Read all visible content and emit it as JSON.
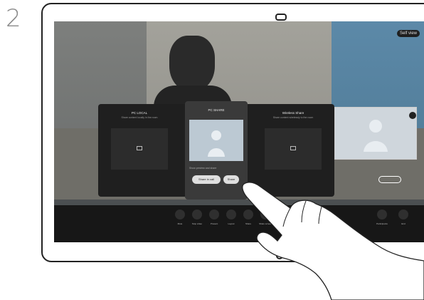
{
  "step": {
    "number": "2"
  },
  "selfview": {
    "badge": "Self view"
  },
  "share": {
    "left": {
      "title": "PC LOCAL",
      "subtitle": "Share content locally in the room"
    },
    "middle": {
      "title": "PC SHARE",
      "option": "Show preview and share",
      "buttons": [
        "Share in call",
        "Share"
      ]
    },
    "right": {
      "title": "Wireless Share",
      "subtitle": "Share content wirelessly to the room"
    }
  },
  "toolbar": {
    "items": [
      {
        "label": "Mute"
      },
      {
        "label": "Stop video"
      },
      {
        "label": "Present"
      },
      {
        "label": "Layout"
      },
      {
        "label": "Share"
      },
      {
        "label": "Share screen"
      },
      {
        "label": "Participants"
      },
      {
        "label": "End"
      }
    ]
  }
}
